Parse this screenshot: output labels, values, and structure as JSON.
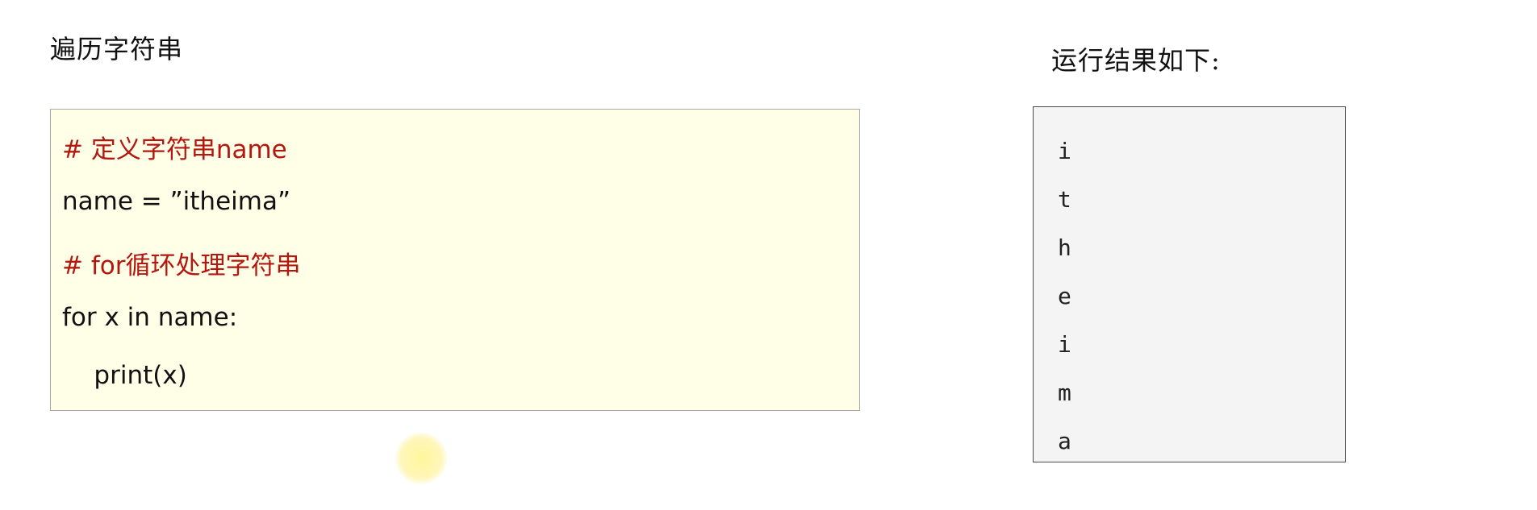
{
  "heading_left": "遍历字符串",
  "heading_right": "运行结果如下:",
  "code_lines": [
    {
      "text": "# 定义字符串name",
      "kind": "comment"
    },
    {
      "text": "name = ”itheima”",
      "kind": "code"
    },
    {
      "text": "# for循环处理字符串",
      "kind": "comment"
    },
    {
      "text": "for x in name:",
      "kind": "code"
    },
    {
      "text": "    print(x)",
      "kind": "code"
    }
  ],
  "output_lines": [
    "i",
    "t",
    "h",
    "e",
    "i",
    "m",
    "a"
  ],
  "colors": {
    "comment": "#b3170f",
    "code_bg": "#ffffe8",
    "output_bg": "#f4f4f4"
  }
}
